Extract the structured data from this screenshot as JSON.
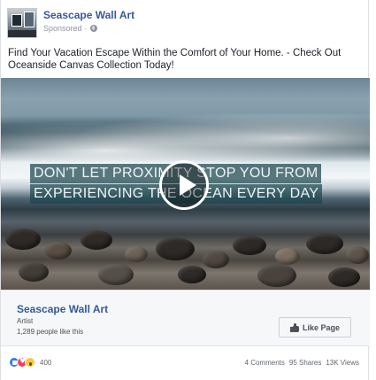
{
  "post": {
    "page_name": "Seascape Wall Art",
    "sponsored_label": "Sponsored",
    "privacy_icon": "globe-icon",
    "body_text": "Find Your Vacation Escape Within the Comfort of Your Home. - Check Out Oceanside Canvas Collection Today!"
  },
  "media": {
    "overlay_line1": "DON'T LET PROXIMITY STOP YOU FROM",
    "overlay_line2": "EXPERIENCING THE OCEAN EVERY DAY",
    "play_icon": "play-icon"
  },
  "page_card": {
    "name": "Seascape Wall Art",
    "category": "Artist",
    "likes": "1,289 people like this",
    "like_button": "Like Page"
  },
  "footer": {
    "reaction_icons": [
      "like-icon",
      "love-icon",
      "wow-icon"
    ],
    "reaction_count": "400",
    "comments": "4 Comments",
    "shares": "95 Shares",
    "views": "13K Views"
  },
  "colors": {
    "link_blue": "#365899",
    "meta_gray": "#90949c",
    "overlay_teal": "#1c464e"
  }
}
